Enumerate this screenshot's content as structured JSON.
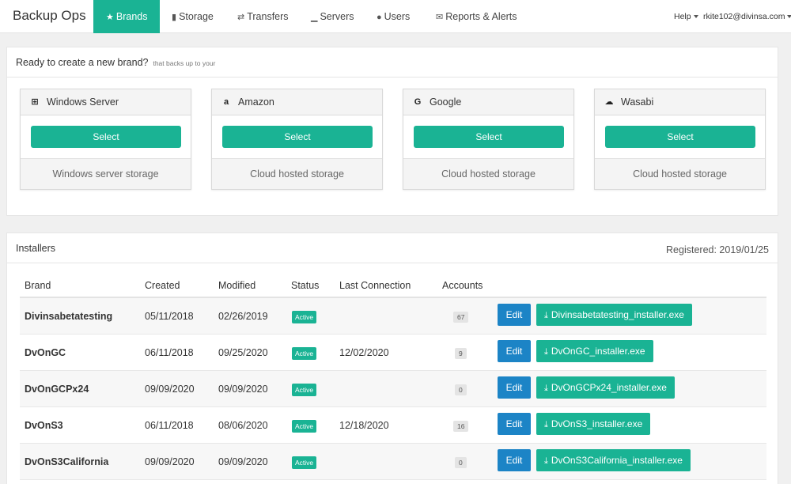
{
  "app": {
    "title": "Backup Ops"
  },
  "nav": {
    "items": [
      {
        "id": "brands",
        "label": "Brands",
        "icon": "star-icon",
        "glyph": "★",
        "active": true
      },
      {
        "id": "storage",
        "label": "Storage",
        "icon": "bar-chart-icon",
        "glyph": "▮"
      },
      {
        "id": "transfers",
        "label": "Transfers",
        "icon": "exchange-icon",
        "glyph": "⇄"
      },
      {
        "id": "servers",
        "label": "Servers",
        "icon": "signal-icon",
        "glyph": "▁"
      },
      {
        "id": "users",
        "label": "Users",
        "icon": "users-icon",
        "glyph": "●"
      },
      {
        "id": "reports",
        "label": "Reports & Alerts",
        "icon": "envelope-icon",
        "glyph": "✉"
      }
    ],
    "help_label": "Help",
    "user_email": "rkite102@divinsa.com"
  },
  "create_panel": {
    "title": "Ready to create a new brand?",
    "subtitle": "that backs up to your",
    "select_label": "Select",
    "cards": [
      {
        "name": "Windows Server",
        "icon": "windows-icon",
        "glyph": "⊞",
        "description": "Windows server storage"
      },
      {
        "name": "Amazon",
        "icon": "amazon-icon",
        "glyph": "a",
        "description": "Cloud hosted storage"
      },
      {
        "name": "Google",
        "icon": "google-icon",
        "glyph": "G",
        "description": "Cloud hosted storage"
      },
      {
        "name": "Wasabi",
        "icon": "cloud-icon",
        "glyph": "☁",
        "description": "Cloud hosted storage"
      }
    ]
  },
  "installers_panel": {
    "title": "Installers",
    "registered": "Registered: 2019/01/25",
    "columns": [
      "Brand",
      "Created",
      "Modified",
      "Status",
      "Last Connection",
      "Accounts"
    ],
    "edit_label": "Edit",
    "rows": [
      {
        "brand": "Divinsabetatesting",
        "created": "05/11/2018",
        "modified": "02/26/2019",
        "status": "Active",
        "last_connection": "",
        "accounts": "67",
        "installer": "Divinsabetatesting_installer.exe"
      },
      {
        "brand": "DvOnGC",
        "created": "06/11/2018",
        "modified": "09/25/2020",
        "status": "Active",
        "last_connection": "12/02/2020",
        "accounts": "9",
        "installer": "DvOnGC_installer.exe"
      },
      {
        "brand": "DvOnGCPx24",
        "created": "09/09/2020",
        "modified": "09/09/2020",
        "status": "Active",
        "last_connection": "",
        "accounts": "0",
        "installer": "DvOnGCPx24_installer.exe"
      },
      {
        "brand": "DvOnS3",
        "created": "06/11/2018",
        "modified": "08/06/2020",
        "status": "Active",
        "last_connection": "12/18/2020",
        "accounts": "16",
        "installer": "DvOnS3_installer.exe"
      },
      {
        "brand": "DvOnS3California",
        "created": "09/09/2020",
        "modified": "09/09/2020",
        "status": "Active",
        "last_connection": "",
        "accounts": "0",
        "installer": "DvOnS3California_installer.exe"
      }
    ]
  },
  "colors": {
    "accent": "#1ab394",
    "edit": "#1c84c6"
  }
}
